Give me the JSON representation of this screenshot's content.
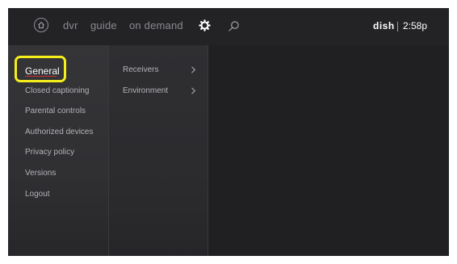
{
  "topbar": {
    "nav": [
      "dvr",
      "guide",
      "on demand"
    ],
    "brand": "dish",
    "time": "2:58p"
  },
  "icons": {
    "home": "home-icon",
    "settings": "gear-icon",
    "search": "search-icon",
    "chevron": "chevron-right-icon"
  },
  "menu": {
    "items": [
      {
        "label": "General",
        "selected": true
      },
      {
        "label": "Closed captioning",
        "selected": false
      },
      {
        "label": "Parental controls",
        "selected": false
      },
      {
        "label": "Authorized devices",
        "selected": false
      },
      {
        "label": "Privacy policy",
        "selected": false
      },
      {
        "label": "Versions",
        "selected": false
      },
      {
        "label": "Logout",
        "selected": false
      }
    ]
  },
  "submenu": {
    "items": [
      {
        "label": "Receivers"
      },
      {
        "label": "Environment"
      }
    ]
  },
  "colors": {
    "highlight": "#f6ee1b",
    "accent_underline": "#c8323a",
    "background": "#262629"
  }
}
